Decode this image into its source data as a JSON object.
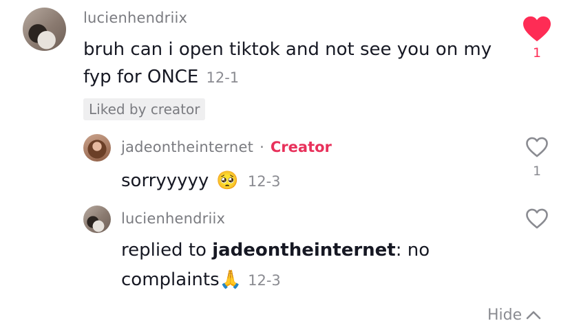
{
  "comments": [
    {
      "username": "lucienhendriix",
      "text_line1": "bruh can i open tiktok and not see you on my",
      "text_line2": "fyp for ONCE",
      "date": "12-1",
      "badge": "Liked by creator",
      "likes": "1",
      "liked": true,
      "like_color": "#fe2c55"
    }
  ],
  "replies": [
    {
      "username": "jadeontheinternet",
      "separator": "·",
      "creator_label": "Creator",
      "text": "sorryyyyy",
      "emoji": "🥺",
      "date": "12-3",
      "likes": "1"
    },
    {
      "username": "lucienhendriix",
      "prefix": "replied to",
      "mention": "jadeontheinternet",
      "suffix": ": no",
      "text_line2": "complaints",
      "emoji": "🙏",
      "date": "12-3"
    }
  ],
  "footer": {
    "hide_label": "Hide"
  },
  "colors": {
    "accent": "#fe2c55",
    "creator": "#e8315b",
    "muted": "#8a8b91"
  }
}
